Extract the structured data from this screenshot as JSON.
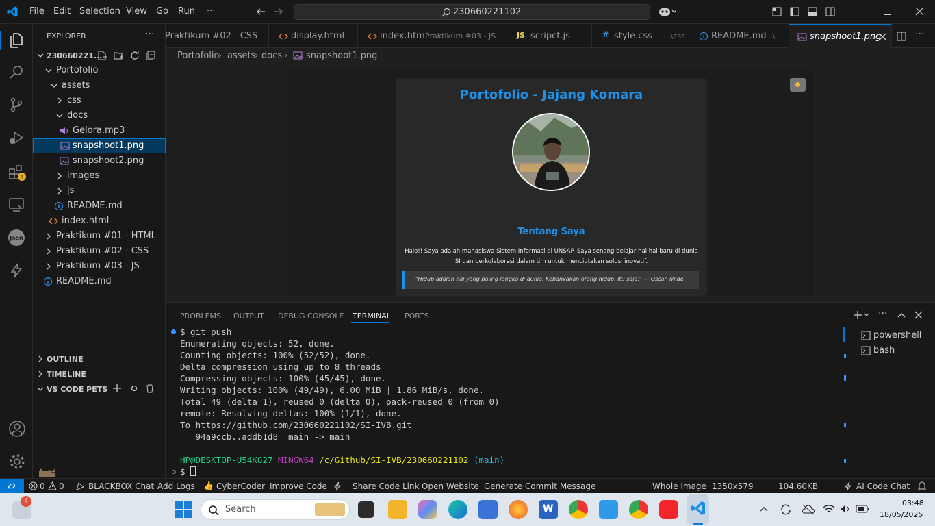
{
  "menu": [
    "File",
    "Edit",
    "Selection",
    "View",
    "Go",
    "Run",
    "···"
  ],
  "search_text": "230660221102",
  "explorer": {
    "title": "EXPLORER",
    "root": "230660221...",
    "items": [
      {
        "label": "Portofolio"
      },
      {
        "label": "assets"
      },
      {
        "label": "css"
      },
      {
        "label": "docs"
      },
      {
        "label": "Gelora.mp3"
      },
      {
        "label": "snapshoot1.png"
      },
      {
        "label": "snapshoot2.png"
      },
      {
        "label": "images"
      },
      {
        "label": "js"
      },
      {
        "label": "README.md"
      },
      {
        "label": "index.html"
      },
      {
        "label": "Praktikum #01 - HTML"
      },
      {
        "label": "Praktikum #02 - CSS"
      },
      {
        "label": "Praktikum #03 - JS"
      },
      {
        "label": "README.md"
      }
    ],
    "sections": [
      "OUTLINE",
      "TIMELINE",
      "VS CODE PETS"
    ]
  },
  "tabs": [
    {
      "name": "Praktikum #02 - CSS",
      "desc": ""
    },
    {
      "name": "display.html",
      "desc": ""
    },
    {
      "name": "index.html",
      "desc": "Praktikum #03 - JS"
    },
    {
      "name": "scripct.js",
      "desc": ""
    },
    {
      "name": "style.css",
      "desc": "...\\css"
    },
    {
      "name": "README.md",
      "desc": ".\\"
    },
    {
      "name": "snapshoot1.png",
      "desc": ""
    }
  ],
  "breadcrumb": [
    "Portofolio",
    "assets",
    "docs",
    "snapshoot1.png"
  ],
  "preview": {
    "heading": "Portofolio - Jajang Komara",
    "section": "Tentang Saya",
    "about": "Halo!! Saya adalah mahasiswa Sistem Informasi di UNSAP. Saya senang belajar hal hal baru di dunia SI dan berkolaborasi dalam tim untuk menciptakan solusi inovatif.",
    "quote": "\"Hidup adalah hal yang paling langka di dunia. Kebanyakan orang hidup, itu saja.\" — Oscar Wilde"
  },
  "panel_tabs": [
    "PROBLEMS",
    "OUTPUT",
    "DEBUG CONSOLE",
    "TERMINAL",
    "PORTS"
  ],
  "terminal": {
    "command": "$ git push",
    "lines": [
      "Enumerating objects: 52, done.",
      "Counting objects: 100% (52/52), done.",
      "Delta compression using up to 8 threads",
      "Compressing objects: 100% (45/45), done.",
      "Writing objects: 100% (49/49), 6.00 MiB | 1.86 MiB/s, done.",
      "Total 49 (delta 1), reused 0 (delta 0), pack-reused 0 (from 0)",
      "remote: Resolving deltas: 100% (1/1), done.",
      "To https://github.com/230660221102/SI-IVB.git",
      "   94a9ccb..addb1d8  main -> main"
    ],
    "prompt_user": "HP@DESKTOP-U54KG27",
    "prompt_env": "MINGW64",
    "prompt_path": "/c/Github/SI-IVB/230660221102",
    "prompt_branch": "(main)",
    "prompt_symbol": "$",
    "shells": [
      "powershell",
      "bash"
    ]
  },
  "status": {
    "errors": "0",
    "warnings": "0",
    "items": [
      "BLACKBOX Chat",
      "Add Logs",
      "CyberCoder",
      "Improve Code",
      "Share Code Link",
      "Open Website",
      "Generate Commit Message"
    ],
    "whole_image": "Whole Image",
    "dimensions": "1350x579",
    "size": "104.60KB",
    "ai_chat": "AI Code Chat"
  },
  "taskbar": {
    "search_placeholder": "Search",
    "weather_badge": "4",
    "time": "03:48",
    "date": "18/05/2025"
  },
  "colors": {
    "accent": "#0078d4",
    "preview_heading": "#1e90e8",
    "terminal_green": "#23d18b",
    "terminal_purple": "#bc3fbc",
    "terminal_yellow": "#e5e510",
    "terminal_cyan": "#29b8db"
  }
}
